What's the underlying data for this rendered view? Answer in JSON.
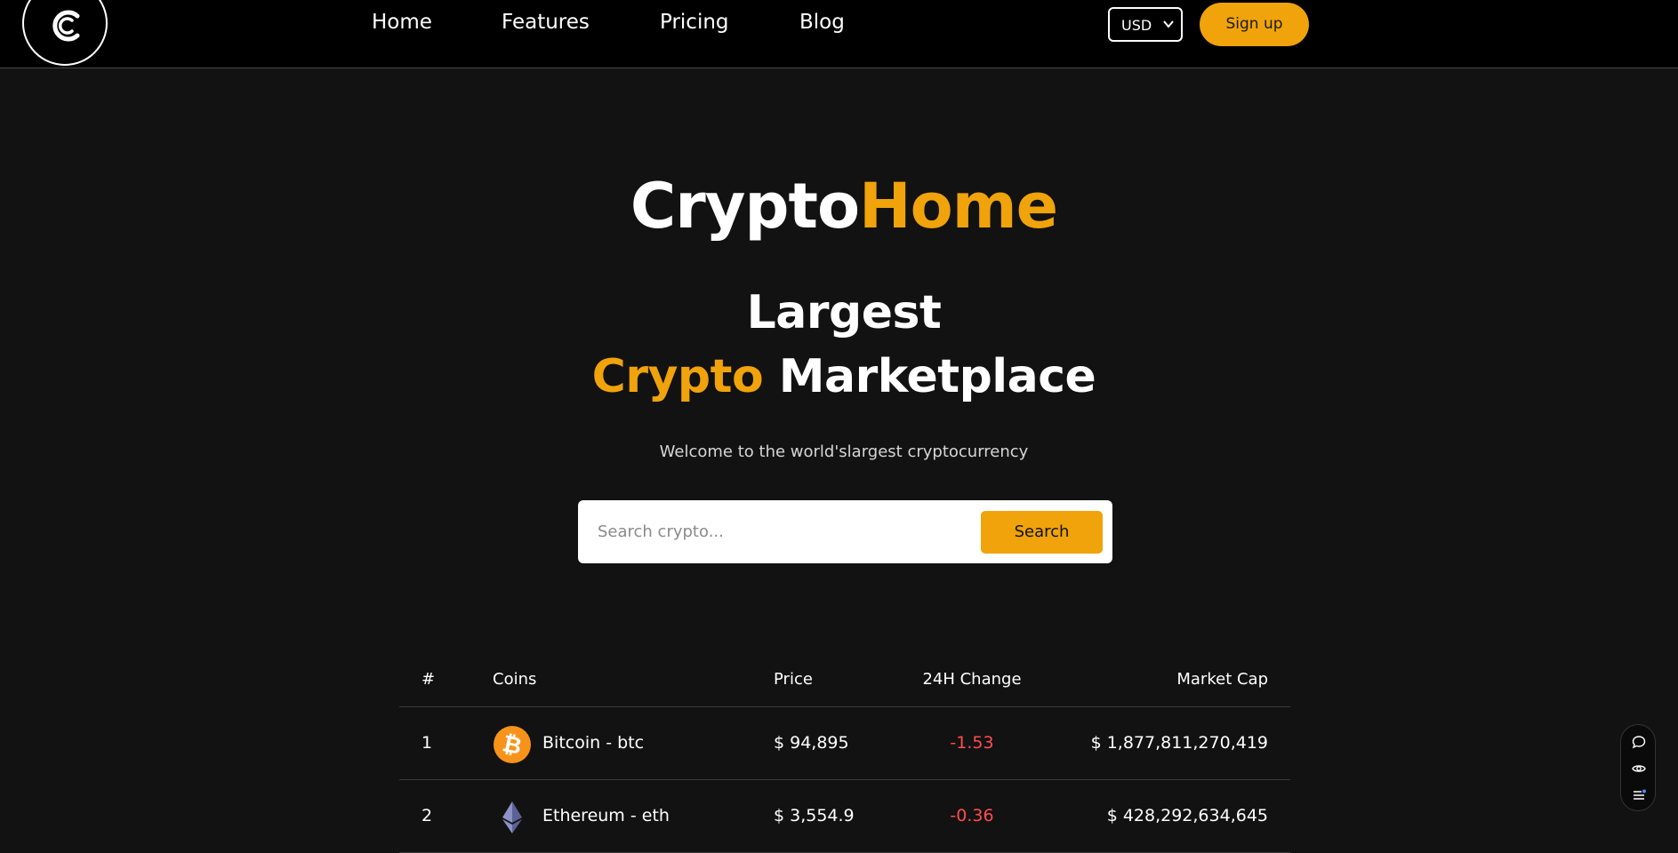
{
  "header": {
    "nav": [
      "Home",
      "Features",
      "Pricing",
      "Blog"
    ],
    "currency": "USD",
    "signup_label": "Sign up"
  },
  "hero": {
    "brand_white": "Crypto",
    "brand_accent": "Home",
    "headline_line1": "Largest",
    "headline_accent": "Crypto",
    "headline_rest": "Marketplace",
    "tagline": "Welcome to the world'slargest cryptocurrency"
  },
  "search": {
    "placeholder": "Search crypto...",
    "button_label": "Search"
  },
  "table": {
    "headers": [
      "#",
      "Coins",
      "Price",
      "24H Change",
      "Market Cap"
    ],
    "rows": [
      {
        "rank": "1",
        "coin": "Bitcoin - btc",
        "price": "$ 94,895",
        "change": "-1.53",
        "market_cap": "$ 1,877,811,270,419",
        "icon": "bitcoin-icon"
      },
      {
        "rank": "2",
        "coin": "Ethereum - eth",
        "price": "$ 3,554.9",
        "change": "-0.36",
        "market_cap": "$ 428,292,634,645",
        "icon": "ethereum-icon"
      }
    ]
  },
  "colors": {
    "accent": "#f0a30a",
    "background": "#121212",
    "header": "#000000",
    "negative": "#ff4d4d"
  },
  "side_widget": {
    "icons": [
      "chat-icon",
      "eye-icon",
      "list-icon"
    ]
  }
}
